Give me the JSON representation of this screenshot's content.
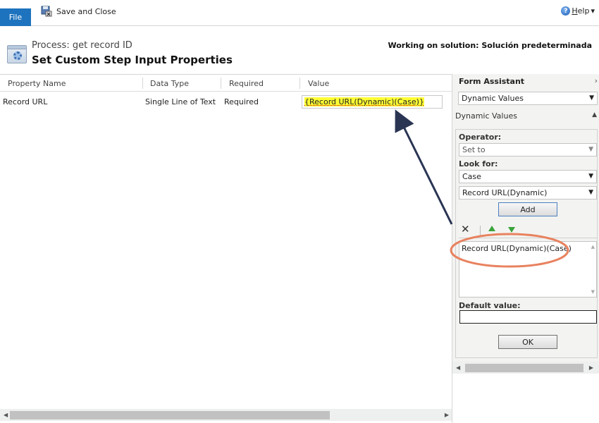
{
  "ribbon": {
    "file_tab": "File",
    "save_close": "Save and Close",
    "help": "Help",
    "help_icon_glyph": "?",
    "help_dropdown_glyph": "▾"
  },
  "header": {
    "process_label": "Process: get record ID",
    "title": "Set Custom Step Input Properties",
    "solution": "Working on solution: Solución predeterminada"
  },
  "grid": {
    "columns": [
      "Property Name",
      "Data Type",
      "Required",
      "Value"
    ],
    "rows": [
      {
        "property_name": "Record URL",
        "data_type": "Single Line of Text",
        "required": "Required",
        "value": "{Record URL(Dynamic)(Case)}"
      }
    ],
    "scroll_left_glyph": "◀",
    "scroll_right_glyph": "▶"
  },
  "form_assistant": {
    "title": "Form Assistant",
    "expand_glyph": "›",
    "mode_select": "Dynamic Values",
    "dropdown_glyph": "▼",
    "section_label": "Dynamic Values",
    "collapse_glyph": "▲",
    "operator_label": "Operator:",
    "operator_value": "Set to",
    "look_for_label": "Look for:",
    "look_for_entity": "Case",
    "look_for_field": "Record URL(Dynamic)",
    "add_button": "Add",
    "delete_glyph": "✕",
    "list_items": [
      "Record URL(Dynamic)(Case)"
    ],
    "list_scroll_up_glyph": "▲",
    "list_scroll_down_glyph": "▼",
    "default_value_label": "Default value:",
    "default_value": "",
    "ok_button": "OK",
    "scroll_left_glyph": "◀",
    "scroll_right_glyph": "▶"
  },
  "annotations": {
    "arrow_color": "#2a3553",
    "ellipse_color": "#e8825f"
  },
  "colors": {
    "file_tab": "#1e73be",
    "highlight": "#ffff33"
  }
}
